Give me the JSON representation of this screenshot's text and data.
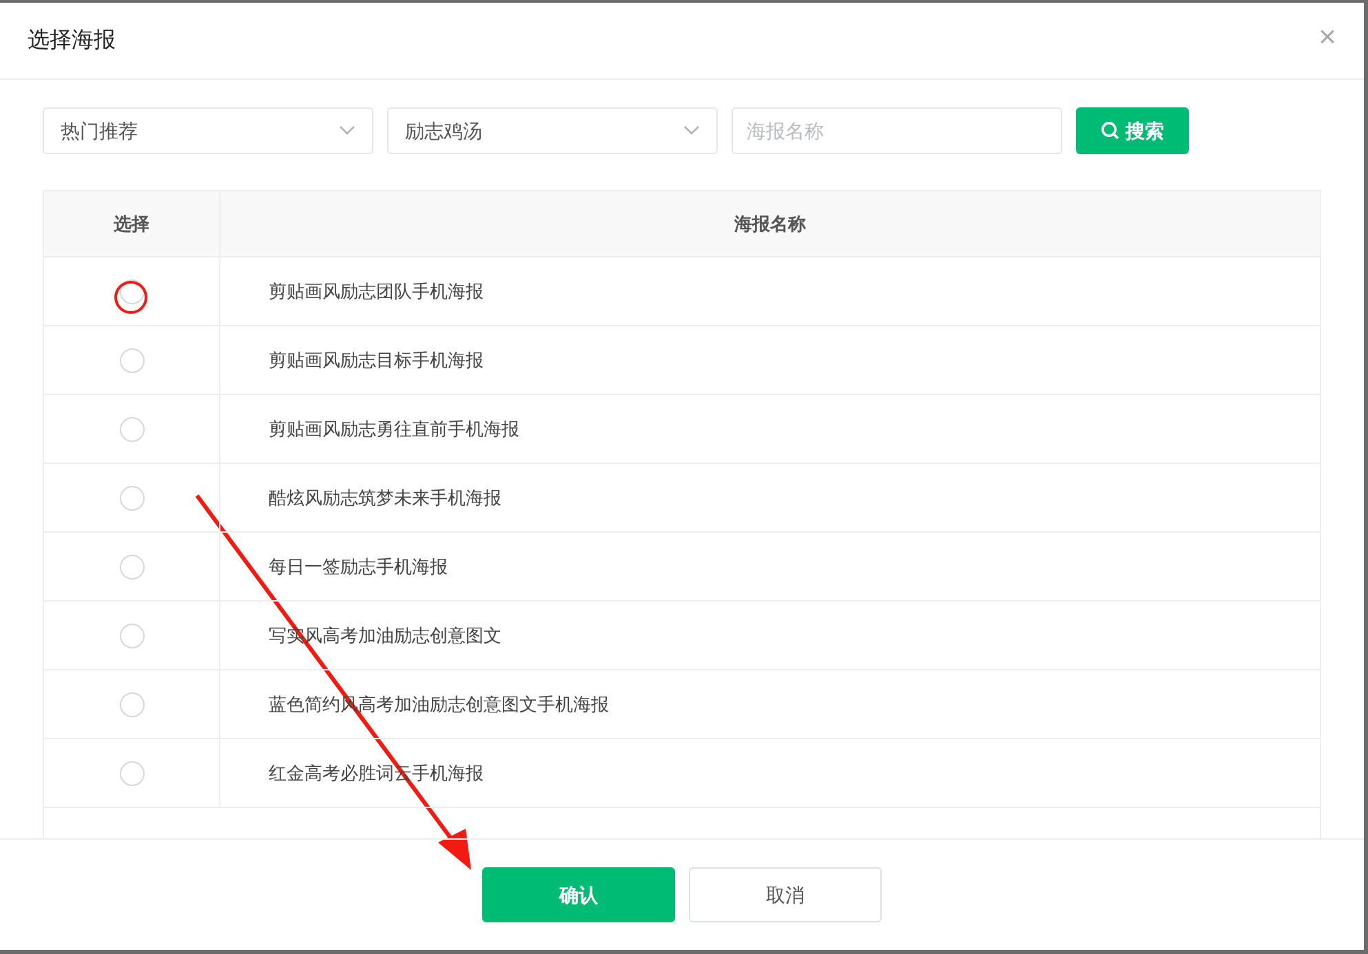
{
  "dialog": {
    "title": "选择海报",
    "close": "×"
  },
  "filters": {
    "category": "热门推荐",
    "topic": "励志鸡汤",
    "search": {
      "placeholder": "海报名称"
    },
    "search_button": "搜索"
  },
  "table": {
    "columns": [
      "选择",
      "海报名称"
    ],
    "rows": [
      {
        "name": "剪贴画风励志团队手机海报",
        "selected": false,
        "circled": true
      },
      {
        "name": "剪贴画风励志目标手机海报",
        "selected": false,
        "circled": false
      },
      {
        "name": "剪贴画风励志勇往直前手机海报",
        "selected": false,
        "circled": false
      },
      {
        "name": "酷炫风励志筑梦未来手机海报",
        "selected": false,
        "circled": false
      },
      {
        "name": "每日一签励志手机海报",
        "selected": false,
        "circled": false
      },
      {
        "name": "写实风高考加油励志创意图文",
        "selected": false,
        "circled": false
      },
      {
        "name": "蓝色简约风高考加油励志创意图文手机海报",
        "selected": false,
        "circled": false
      },
      {
        "name": "红金高考必胜词云手机海报",
        "selected": false,
        "circled": false
      }
    ]
  },
  "buttons": [
    {
      "label": "确认",
      "kind": "primary"
    },
    {
      "label": "取消",
      "kind": "default"
    }
  ],
  "annotations": {
    "arrow": true
  }
}
